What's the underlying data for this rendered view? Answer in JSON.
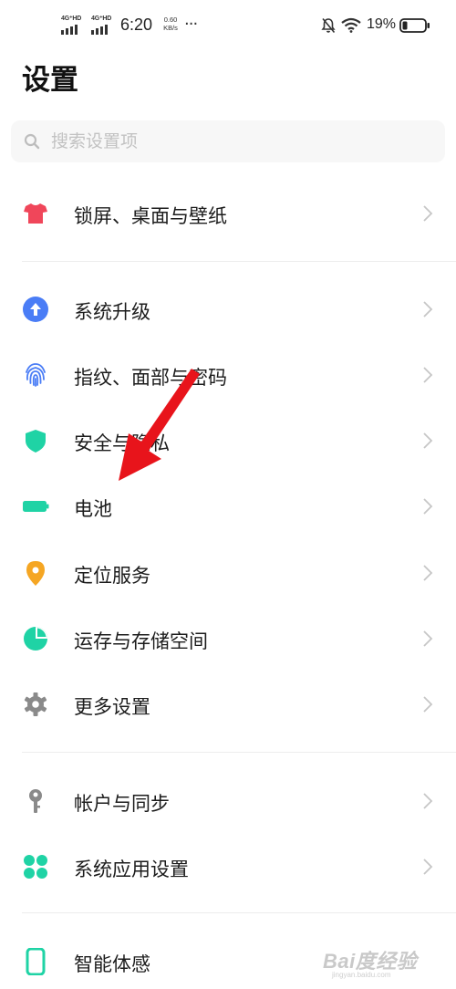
{
  "status_bar": {
    "sim1_tag": "4G⁺HD",
    "sim2_tag": "4G⁺HD",
    "time": "6:20",
    "net_speed_value": "0.60",
    "net_speed_unit": "KB/s",
    "more": "···",
    "battery_percent": "19%"
  },
  "page": {
    "title": "设置"
  },
  "search": {
    "placeholder": "搜索设置项"
  },
  "items": [
    {
      "label": "锁屏、桌面与壁纸",
      "icon": "tshirt-icon",
      "color": "#f0465a"
    },
    {
      "label": "系统升级",
      "icon": "arrow-up-circle-icon",
      "color": "#4a7df6"
    },
    {
      "label": "指纹、面部与密码",
      "icon": "fingerprint-icon",
      "color": "#4a7df6"
    },
    {
      "label": "安全与隐私",
      "icon": "shield-icon",
      "color": "#1fd3a5"
    },
    {
      "label": "电池",
      "icon": "battery-icon",
      "color": "#1fd3a5"
    },
    {
      "label": "定位服务",
      "icon": "location-pin-icon",
      "color": "#f5a623"
    },
    {
      "label": "运存与存储空间",
      "icon": "storage-pie-icon",
      "color": "#1fd3a5"
    },
    {
      "label": "更多设置",
      "icon": "gear-icon",
      "color": "#8a8a8a"
    },
    {
      "label": "帐户与同步",
      "icon": "key-icon",
      "color": "#8a8a8a"
    },
    {
      "label": "系统应用设置",
      "icon": "app-grid-icon",
      "color": "#1fd3a5"
    },
    {
      "label": "智能体感",
      "icon": "phone-icon",
      "color": "#1fd3a5"
    }
  ],
  "annotation": {
    "color": "#e8141b"
  },
  "watermark": {
    "text": "Bai度经验",
    "url": "jingyan.baidu.com"
  }
}
